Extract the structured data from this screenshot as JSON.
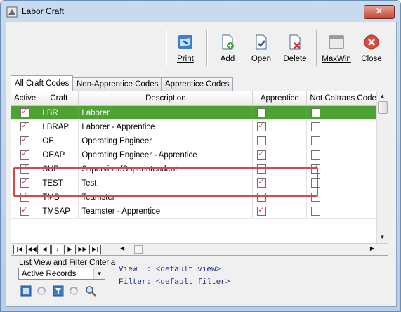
{
  "window": {
    "title": "Labor Craft",
    "close_glyph": "✕"
  },
  "toolbar": {
    "print": "Print",
    "add": "Add",
    "open": "Open",
    "delete": "Delete",
    "maxwin": "MaxWin",
    "close": "Close"
  },
  "tabs": [
    "All Craft Codes",
    "Non-Apprentice Codes",
    "Apprentice Codes"
  ],
  "grid": {
    "headers": [
      "Active",
      "Craft",
      "Description",
      "Apprentice",
      "Not Caltrans Code"
    ],
    "rows": [
      {
        "active": true,
        "craft": "LBR",
        "description": "Laborer",
        "apprentice": false,
        "not_caltrans": false
      },
      {
        "active": true,
        "craft": "LBRAP",
        "description": "Laborer - Apprentice",
        "apprentice": true,
        "not_caltrans": false
      },
      {
        "active": true,
        "craft": "OE",
        "description": "Operating Engineer",
        "apprentice": false,
        "not_caltrans": false
      },
      {
        "active": true,
        "craft": "OEAP",
        "description": "Operating Engineer - Apprentice",
        "apprentice": true,
        "not_caltrans": false
      },
      {
        "active": true,
        "craft": "SUP",
        "description": "Supervisor/Superintendent",
        "apprentice": false,
        "not_caltrans": true
      },
      {
        "active": true,
        "craft": "TEST",
        "description": "Test",
        "apprentice": true,
        "not_caltrans": false
      },
      {
        "active": true,
        "craft": "TMS",
        "description": "Teamster",
        "apprentice": false,
        "not_caltrans": false
      },
      {
        "active": true,
        "craft": "TMSAP",
        "description": "Teamster - Apprentice",
        "apprentice": true,
        "not_caltrans": false
      }
    ],
    "navigator": [
      "|◀",
      "◀◀",
      "◀",
      "?",
      "▶",
      "▶▶",
      "▶|"
    ]
  },
  "filter": {
    "label": "List View and Filter Criteria",
    "selected": "Active Records",
    "view_line": "View  : <default view>",
    "filter_line": "Filter: <default filter>"
  },
  "colors": {
    "selected_row": "#4ea133",
    "highlight_box": "#d9474a",
    "check": "#d63a3a"
  }
}
